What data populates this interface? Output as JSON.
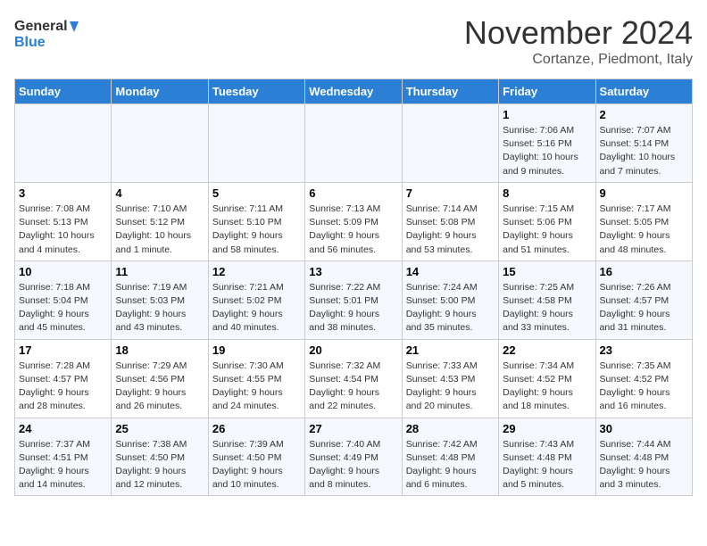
{
  "header": {
    "logo_general": "General",
    "logo_blue": "Blue",
    "month_title": "November 2024",
    "location": "Cortanze, Piedmont, Italy"
  },
  "weekdays": [
    "Sunday",
    "Monday",
    "Tuesday",
    "Wednesday",
    "Thursday",
    "Friday",
    "Saturday"
  ],
  "weeks": [
    [
      {
        "day": "",
        "info": ""
      },
      {
        "day": "",
        "info": ""
      },
      {
        "day": "",
        "info": ""
      },
      {
        "day": "",
        "info": ""
      },
      {
        "day": "",
        "info": ""
      },
      {
        "day": "1",
        "info": "Sunrise: 7:06 AM\nSunset: 5:16 PM\nDaylight: 10 hours\nand 9 minutes."
      },
      {
        "day": "2",
        "info": "Sunrise: 7:07 AM\nSunset: 5:14 PM\nDaylight: 10 hours\nand 7 minutes."
      }
    ],
    [
      {
        "day": "3",
        "info": "Sunrise: 7:08 AM\nSunset: 5:13 PM\nDaylight: 10 hours\nand 4 minutes."
      },
      {
        "day": "4",
        "info": "Sunrise: 7:10 AM\nSunset: 5:12 PM\nDaylight: 10 hours\nand 1 minute."
      },
      {
        "day": "5",
        "info": "Sunrise: 7:11 AM\nSunset: 5:10 PM\nDaylight: 9 hours\nand 58 minutes."
      },
      {
        "day": "6",
        "info": "Sunrise: 7:13 AM\nSunset: 5:09 PM\nDaylight: 9 hours\nand 56 minutes."
      },
      {
        "day": "7",
        "info": "Sunrise: 7:14 AM\nSunset: 5:08 PM\nDaylight: 9 hours\nand 53 minutes."
      },
      {
        "day": "8",
        "info": "Sunrise: 7:15 AM\nSunset: 5:06 PM\nDaylight: 9 hours\nand 51 minutes."
      },
      {
        "day": "9",
        "info": "Sunrise: 7:17 AM\nSunset: 5:05 PM\nDaylight: 9 hours\nand 48 minutes."
      }
    ],
    [
      {
        "day": "10",
        "info": "Sunrise: 7:18 AM\nSunset: 5:04 PM\nDaylight: 9 hours\nand 45 minutes."
      },
      {
        "day": "11",
        "info": "Sunrise: 7:19 AM\nSunset: 5:03 PM\nDaylight: 9 hours\nand 43 minutes."
      },
      {
        "day": "12",
        "info": "Sunrise: 7:21 AM\nSunset: 5:02 PM\nDaylight: 9 hours\nand 40 minutes."
      },
      {
        "day": "13",
        "info": "Sunrise: 7:22 AM\nSunset: 5:01 PM\nDaylight: 9 hours\nand 38 minutes."
      },
      {
        "day": "14",
        "info": "Sunrise: 7:24 AM\nSunset: 5:00 PM\nDaylight: 9 hours\nand 35 minutes."
      },
      {
        "day": "15",
        "info": "Sunrise: 7:25 AM\nSunset: 4:58 PM\nDaylight: 9 hours\nand 33 minutes."
      },
      {
        "day": "16",
        "info": "Sunrise: 7:26 AM\nSunset: 4:57 PM\nDaylight: 9 hours\nand 31 minutes."
      }
    ],
    [
      {
        "day": "17",
        "info": "Sunrise: 7:28 AM\nSunset: 4:57 PM\nDaylight: 9 hours\nand 28 minutes."
      },
      {
        "day": "18",
        "info": "Sunrise: 7:29 AM\nSunset: 4:56 PM\nDaylight: 9 hours\nand 26 minutes."
      },
      {
        "day": "19",
        "info": "Sunrise: 7:30 AM\nSunset: 4:55 PM\nDaylight: 9 hours\nand 24 minutes."
      },
      {
        "day": "20",
        "info": "Sunrise: 7:32 AM\nSunset: 4:54 PM\nDaylight: 9 hours\nand 22 minutes."
      },
      {
        "day": "21",
        "info": "Sunrise: 7:33 AM\nSunset: 4:53 PM\nDaylight: 9 hours\nand 20 minutes."
      },
      {
        "day": "22",
        "info": "Sunrise: 7:34 AM\nSunset: 4:52 PM\nDaylight: 9 hours\nand 18 minutes."
      },
      {
        "day": "23",
        "info": "Sunrise: 7:35 AM\nSunset: 4:52 PM\nDaylight: 9 hours\nand 16 minutes."
      }
    ],
    [
      {
        "day": "24",
        "info": "Sunrise: 7:37 AM\nSunset: 4:51 PM\nDaylight: 9 hours\nand 14 minutes."
      },
      {
        "day": "25",
        "info": "Sunrise: 7:38 AM\nSunset: 4:50 PM\nDaylight: 9 hours\nand 12 minutes."
      },
      {
        "day": "26",
        "info": "Sunrise: 7:39 AM\nSunset: 4:50 PM\nDaylight: 9 hours\nand 10 minutes."
      },
      {
        "day": "27",
        "info": "Sunrise: 7:40 AM\nSunset: 4:49 PM\nDaylight: 9 hours\nand 8 minutes."
      },
      {
        "day": "28",
        "info": "Sunrise: 7:42 AM\nSunset: 4:48 PM\nDaylight: 9 hours\nand 6 minutes."
      },
      {
        "day": "29",
        "info": "Sunrise: 7:43 AM\nSunset: 4:48 PM\nDaylight: 9 hours\nand 5 minutes."
      },
      {
        "day": "30",
        "info": "Sunrise: 7:44 AM\nSunset: 4:48 PM\nDaylight: 9 hours\nand 3 minutes."
      }
    ]
  ]
}
